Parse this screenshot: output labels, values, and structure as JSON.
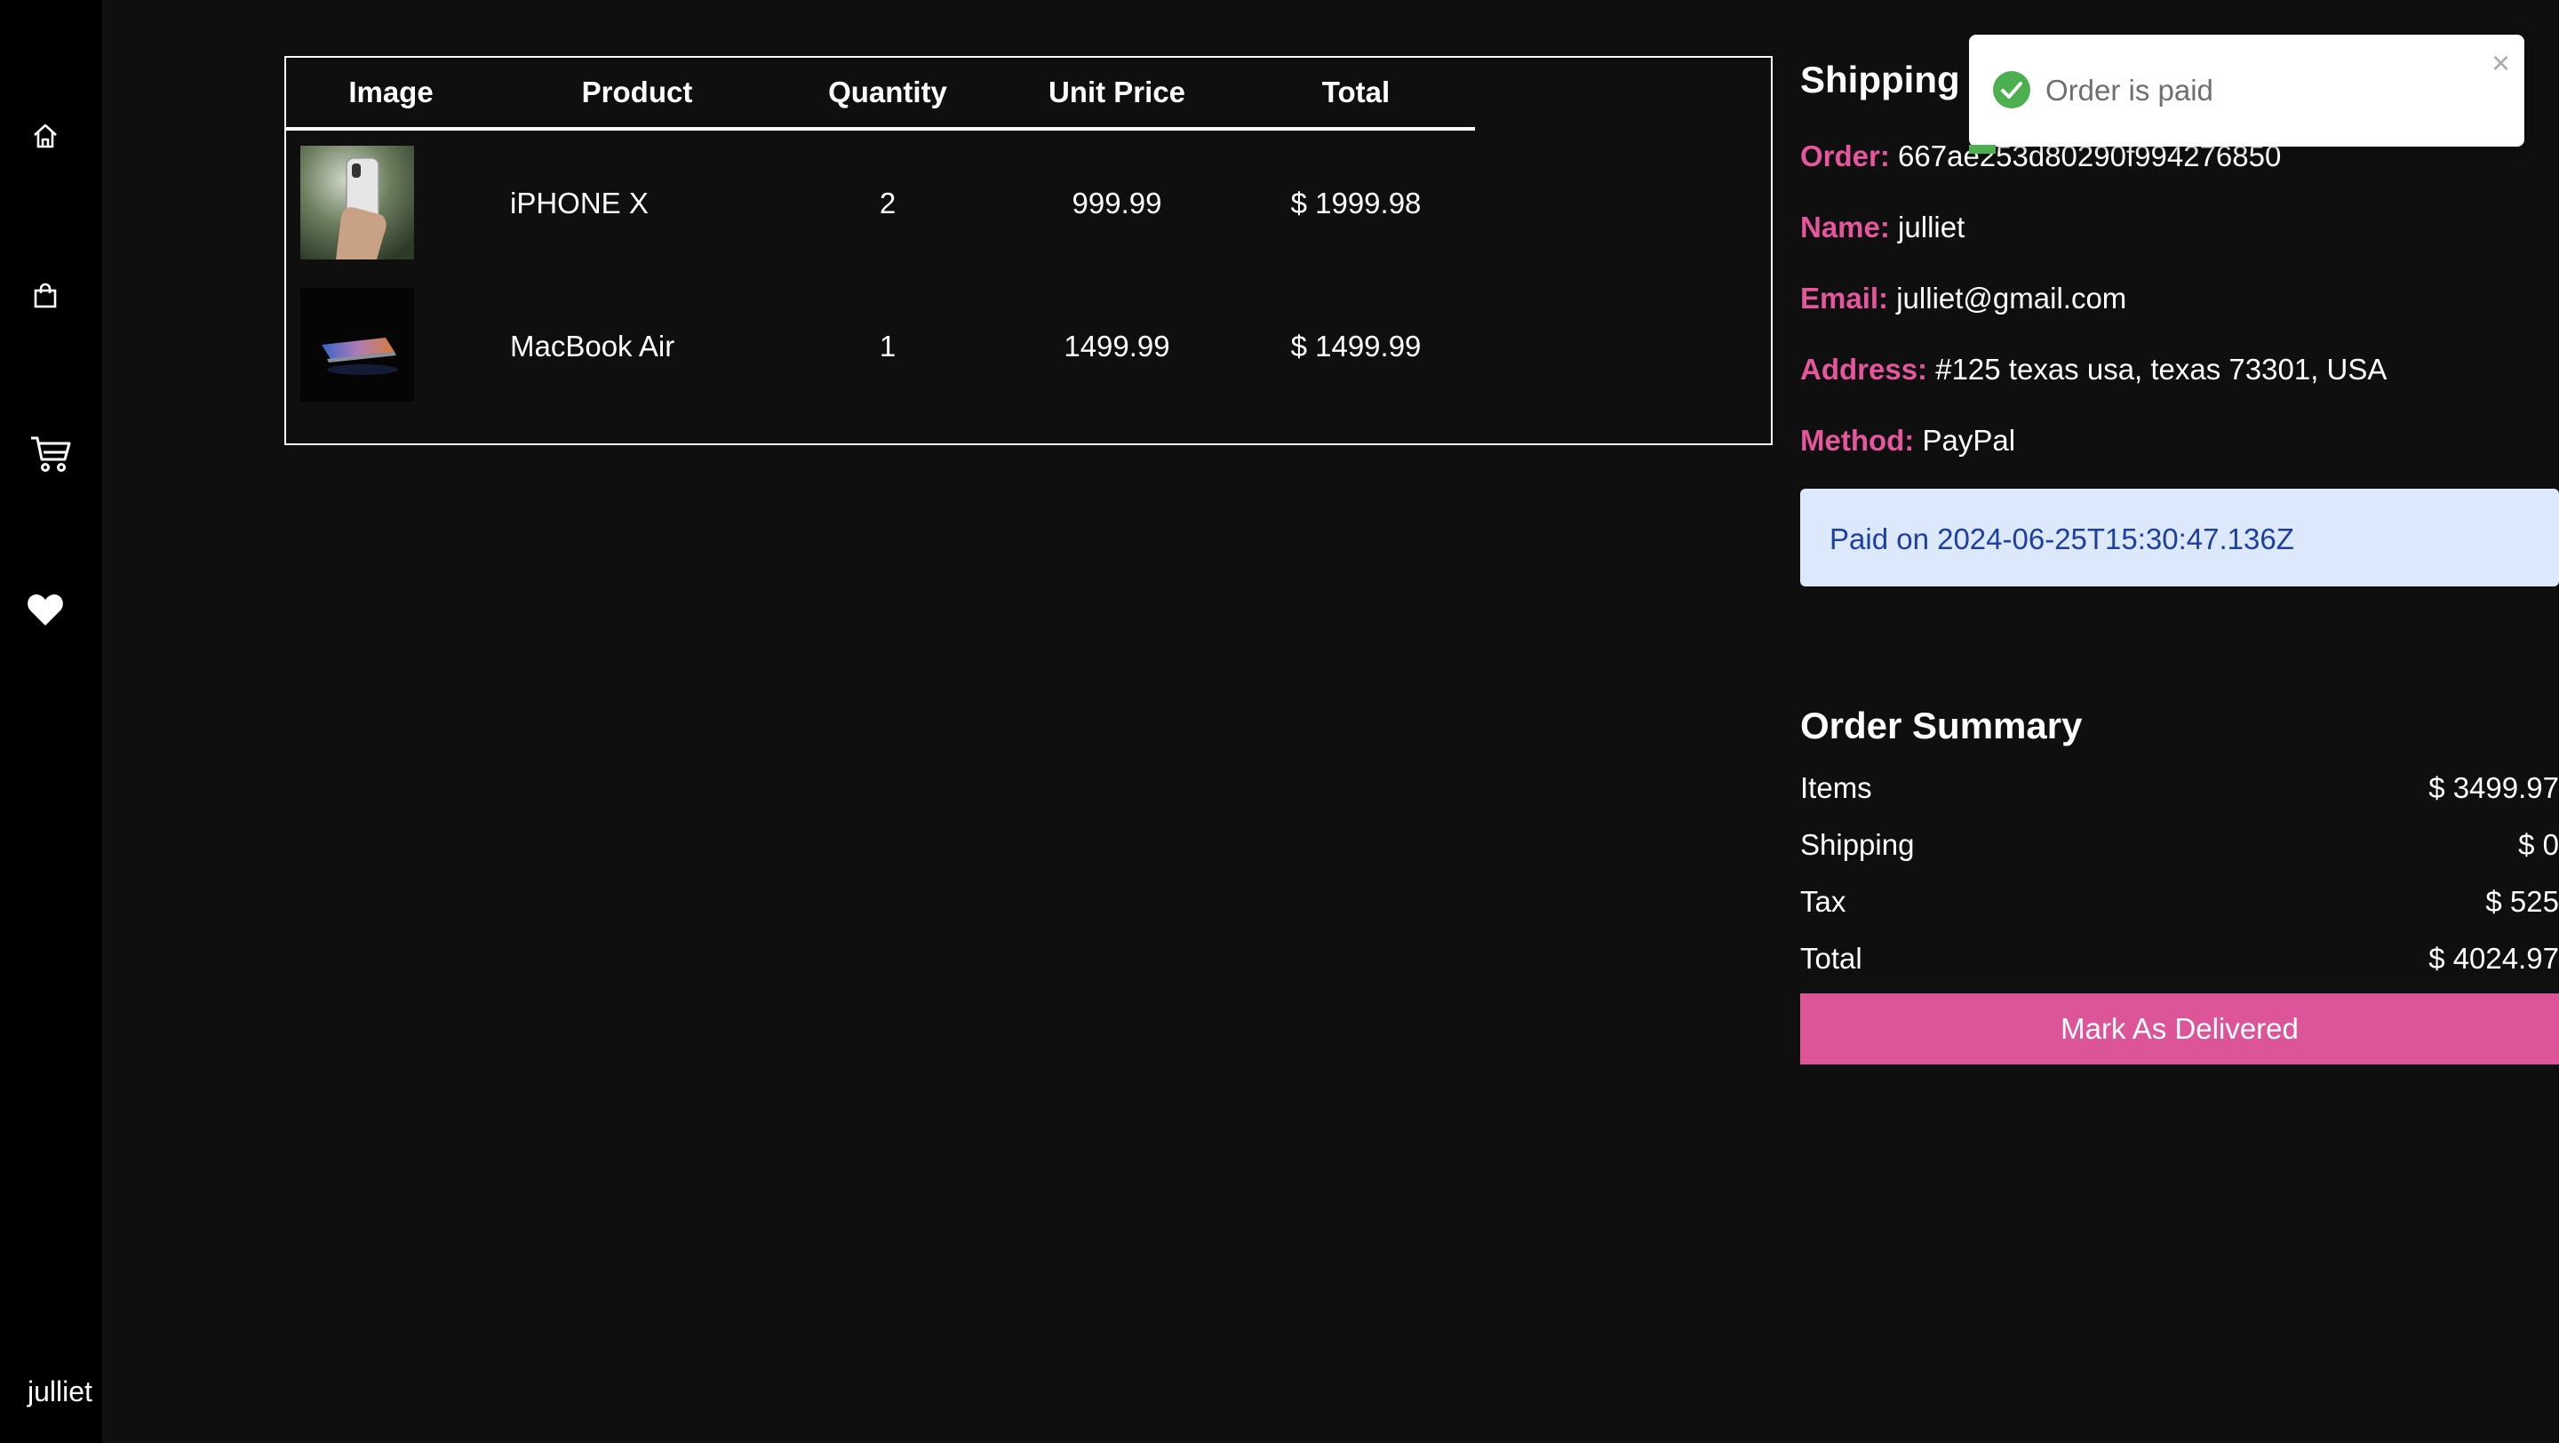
{
  "sidebar": {
    "icons": [
      "home-icon",
      "shopping-bag-icon",
      "cart-icon",
      "heart-icon"
    ],
    "username": "julliet"
  },
  "table": {
    "headers": [
      "Image",
      "Product",
      "Quantity",
      "Unit Price",
      "Total"
    ],
    "rows": [
      {
        "product": "iPHONE X",
        "quantity": "2",
        "unit_price": "999.99",
        "total": "$ 1999.98"
      },
      {
        "product": "MacBook Air",
        "quantity": "1",
        "unit_price": "1499.99",
        "total": "$ 1499.99"
      }
    ]
  },
  "shipping": {
    "title": "Shipping",
    "order_label": "Order:",
    "order_value": "667ae253d80290f994276850",
    "name_label": "Name:",
    "name_value": "julliet",
    "email_label": "Email:",
    "email_value": "julliet@gmail.com",
    "address_label": "Address:",
    "address_value": "#125 texas usa, texas 73301, USA",
    "method_label": "Method:",
    "method_value": "PayPal",
    "paid_message": "Paid on 2024-06-25T15:30:47.136Z"
  },
  "summary": {
    "title": "Order Summary",
    "items_label": "Items",
    "items_value": "$ 3499.97",
    "shipping_label": "Shipping",
    "shipping_value": "$ 0",
    "tax_label": "Tax",
    "tax_value": "$ 525",
    "total_label": "Total",
    "total_value": "$ 4024.97",
    "button_label": "Mark As Delivered"
  },
  "toast": {
    "message": "Order is paid",
    "close": "×"
  },
  "colors": {
    "background": "#0f0f0f",
    "sidebar": "#000000",
    "accent_pink": "#db5598",
    "label_pink": "#e5569c",
    "alert_bg": "#dce8fb",
    "alert_text": "#1e3fa0",
    "success_green": "#4caf50"
  }
}
